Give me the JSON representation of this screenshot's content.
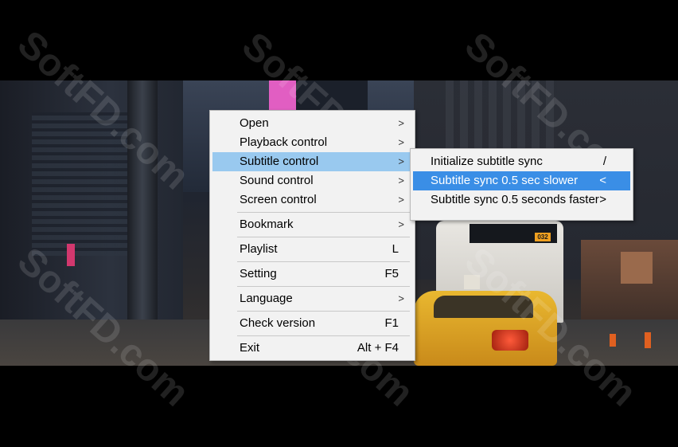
{
  "watermark": "SoftFD.com",
  "video": {
    "bus_number": "032"
  },
  "main_menu": {
    "items": [
      {
        "label": "Open",
        "shortcut": "",
        "submenu": true
      },
      {
        "label": "Playback control",
        "shortcut": "",
        "submenu": true
      },
      {
        "label": "Subtitle control",
        "shortcut": "",
        "submenu": true,
        "highlighted": true
      },
      {
        "label": "Sound control",
        "shortcut": "",
        "submenu": true
      },
      {
        "label": "Screen control",
        "shortcut": "",
        "submenu": true
      },
      {
        "label": "Bookmark",
        "shortcut": "",
        "submenu": true
      },
      {
        "label": "Playlist",
        "shortcut": "L",
        "submenu": false
      },
      {
        "label": "Setting",
        "shortcut": "F5",
        "submenu": false
      },
      {
        "label": "Language",
        "shortcut": "",
        "submenu": true
      },
      {
        "label": "Check version",
        "shortcut": "F1",
        "submenu": false
      },
      {
        "label": "Exit",
        "shortcut": "Alt + F4",
        "submenu": false
      }
    ],
    "submenu_arrow": ">"
  },
  "subtitle_menu": {
    "items": [
      {
        "label": "Initialize subtitle sync",
        "shortcut": "/"
      },
      {
        "label": "Subtitle sync 0.5 sec slower",
        "shortcut": "<",
        "highlighted": true
      },
      {
        "label": "Subtitle sync 0.5 seconds faster",
        "shortcut": ">"
      }
    ]
  },
  "colors": {
    "hover": "#99c9ef",
    "selected": "#3a8ee6",
    "menu_bg": "#f2f2f2"
  }
}
